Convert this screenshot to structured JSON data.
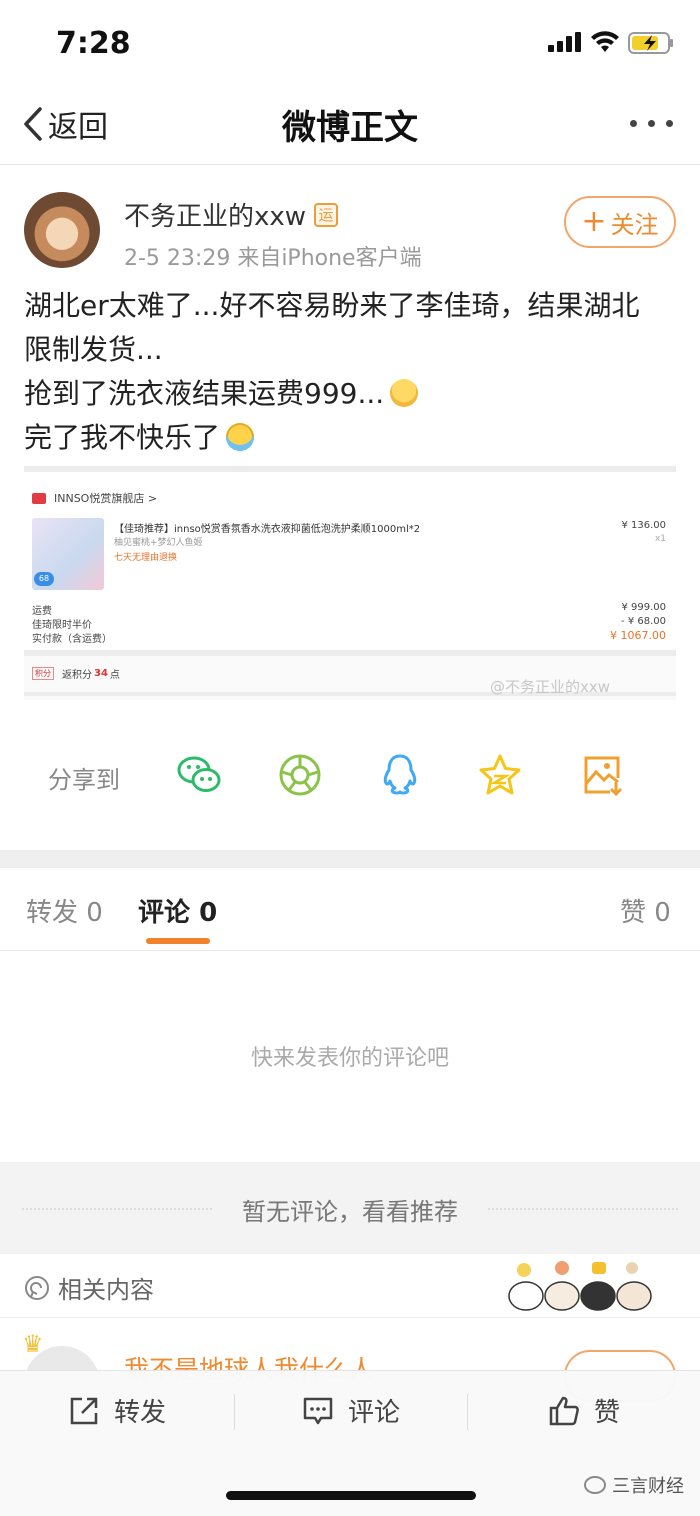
{
  "status_bar": {
    "time": "7:28"
  },
  "nav": {
    "back_label": "返回",
    "title": "微博正文"
  },
  "post": {
    "username": "不务正业的xxw",
    "badge": "运",
    "meta": "2-5 23:29  来自iPhone客户端",
    "follow_label": "关注",
    "follow_plus": "+",
    "text_lines": [
      "湖北er太难了...好不容易盼来了李佳琦，结果湖北",
      "限制发货...",
      "抢到了洗衣液结果运费999...",
      "完了我不快乐了"
    ]
  },
  "order_screenshot": {
    "shop_name": "INNSO悦赏旗舰店 >",
    "product_title": "【佳琦推荐】innso悦赏香氛香水洗衣液抑菌低泡洗护柔顺1000ml*2",
    "product_sub": "柚见蜜桃+梦幻人鱼姬",
    "product_policy": "七天无理由退换",
    "product_tag": "68",
    "product_price": "¥ 136.00",
    "product_qty": "x1",
    "fees": [
      {
        "label": "运费",
        "value": "¥ 999.00"
      },
      {
        "label": "佳琦限时半价",
        "value": "- ¥ 68.00"
      },
      {
        "label": "实付款（含运费）",
        "value": "¥ 1067.00"
      }
    ],
    "points_tag": "积分",
    "points_prefix": "返积分",
    "points_value": "34",
    "points_suffix": "点",
    "watermark": "@不务正业的xxw"
  },
  "share": {
    "label": "分享到"
  },
  "tabs": [
    {
      "label": "转发",
      "count": "0"
    },
    {
      "label": "评论",
      "count": "0"
    },
    {
      "label": "赞",
      "count": "0"
    }
  ],
  "comments": {
    "empty_text": "快来发表你的评论吧"
  },
  "recommend": {
    "text": "暂无评论，看看推荐"
  },
  "related": {
    "label": "相关内容",
    "next_username": "我不是地球人我什么人"
  },
  "bottom_bar": {
    "repost": "转发",
    "comment": "评论",
    "like": "赞"
  },
  "brand": {
    "name": "三言财经"
  },
  "colors": {
    "accent": "#f2812b",
    "follow": "#f08a30",
    "wechat": "#2dbb6a",
    "moments": "#8bc34a",
    "qq": "#3fa9f5",
    "favorite": "#f5c518",
    "save": "#f0a030"
  }
}
